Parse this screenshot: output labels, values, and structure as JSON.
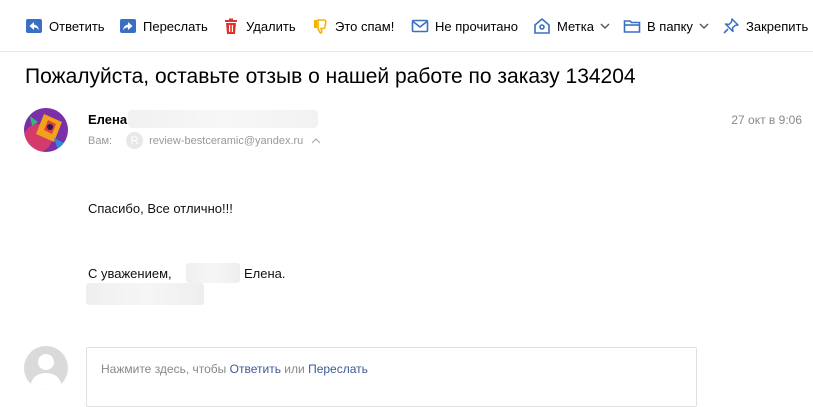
{
  "toolbar": {
    "reply_label": "Ответить",
    "forward_label": "Переслать",
    "delete_label": "Удалить",
    "spam_label": "Это спам!",
    "unread_label": "Не прочитано",
    "label_label": "Метка",
    "folder_label": "В папку",
    "pin_label": "Закрепить"
  },
  "colors": {
    "toolbar_icon": "#3b6fc4",
    "delete_icon": "#e0312d",
    "spam_icon": "#f5b400",
    "link": "#3b5a99",
    "muted_text": "#888888"
  },
  "message": {
    "subject": "Пожалуйста, оставьте отзыв о нашей работе по заказу 134204",
    "sender_name": "Елена",
    "to_label": "Вам:",
    "recipient_icon_letter": "R",
    "recipient_email": "review-bestceramic@yandex.ru",
    "date": "27 окт в 9:06",
    "body_line1": "Спасибо, Все отлично!!!",
    "signature_prefix": "С уважением,",
    "signature_name": "Елена."
  },
  "reply": {
    "prompt": "Нажмите здесь, чтобы",
    "reply_link": "Ответить",
    "or_word": "или",
    "forward_link": "Переслать"
  }
}
